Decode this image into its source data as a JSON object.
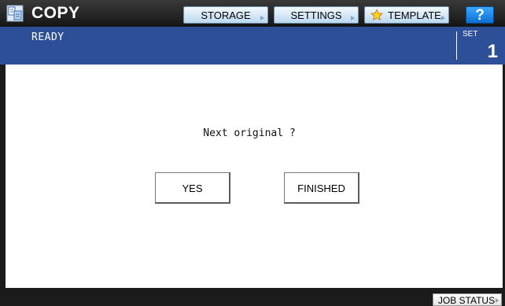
{
  "header": {
    "app_icon": "copy-icon",
    "title": "COPY",
    "buttons": {
      "storage": "STORAGE",
      "settings": "SETTINGS",
      "template": "TEMPLATE",
      "help": "?"
    }
  },
  "status": {
    "text": "READY",
    "set_label": "SET",
    "set_value": "1"
  },
  "dialog": {
    "prompt": "Next original ?",
    "yes_label": "YES",
    "finished_label": "FINISHED"
  },
  "footer": {
    "job_status_label": "JOB STATUS"
  },
  "colors": {
    "status_bar": "#2d4f97",
    "top_bar": "#1b1b1b",
    "tab_button": "#cfe6f6",
    "help_button": "#1a86ea"
  }
}
